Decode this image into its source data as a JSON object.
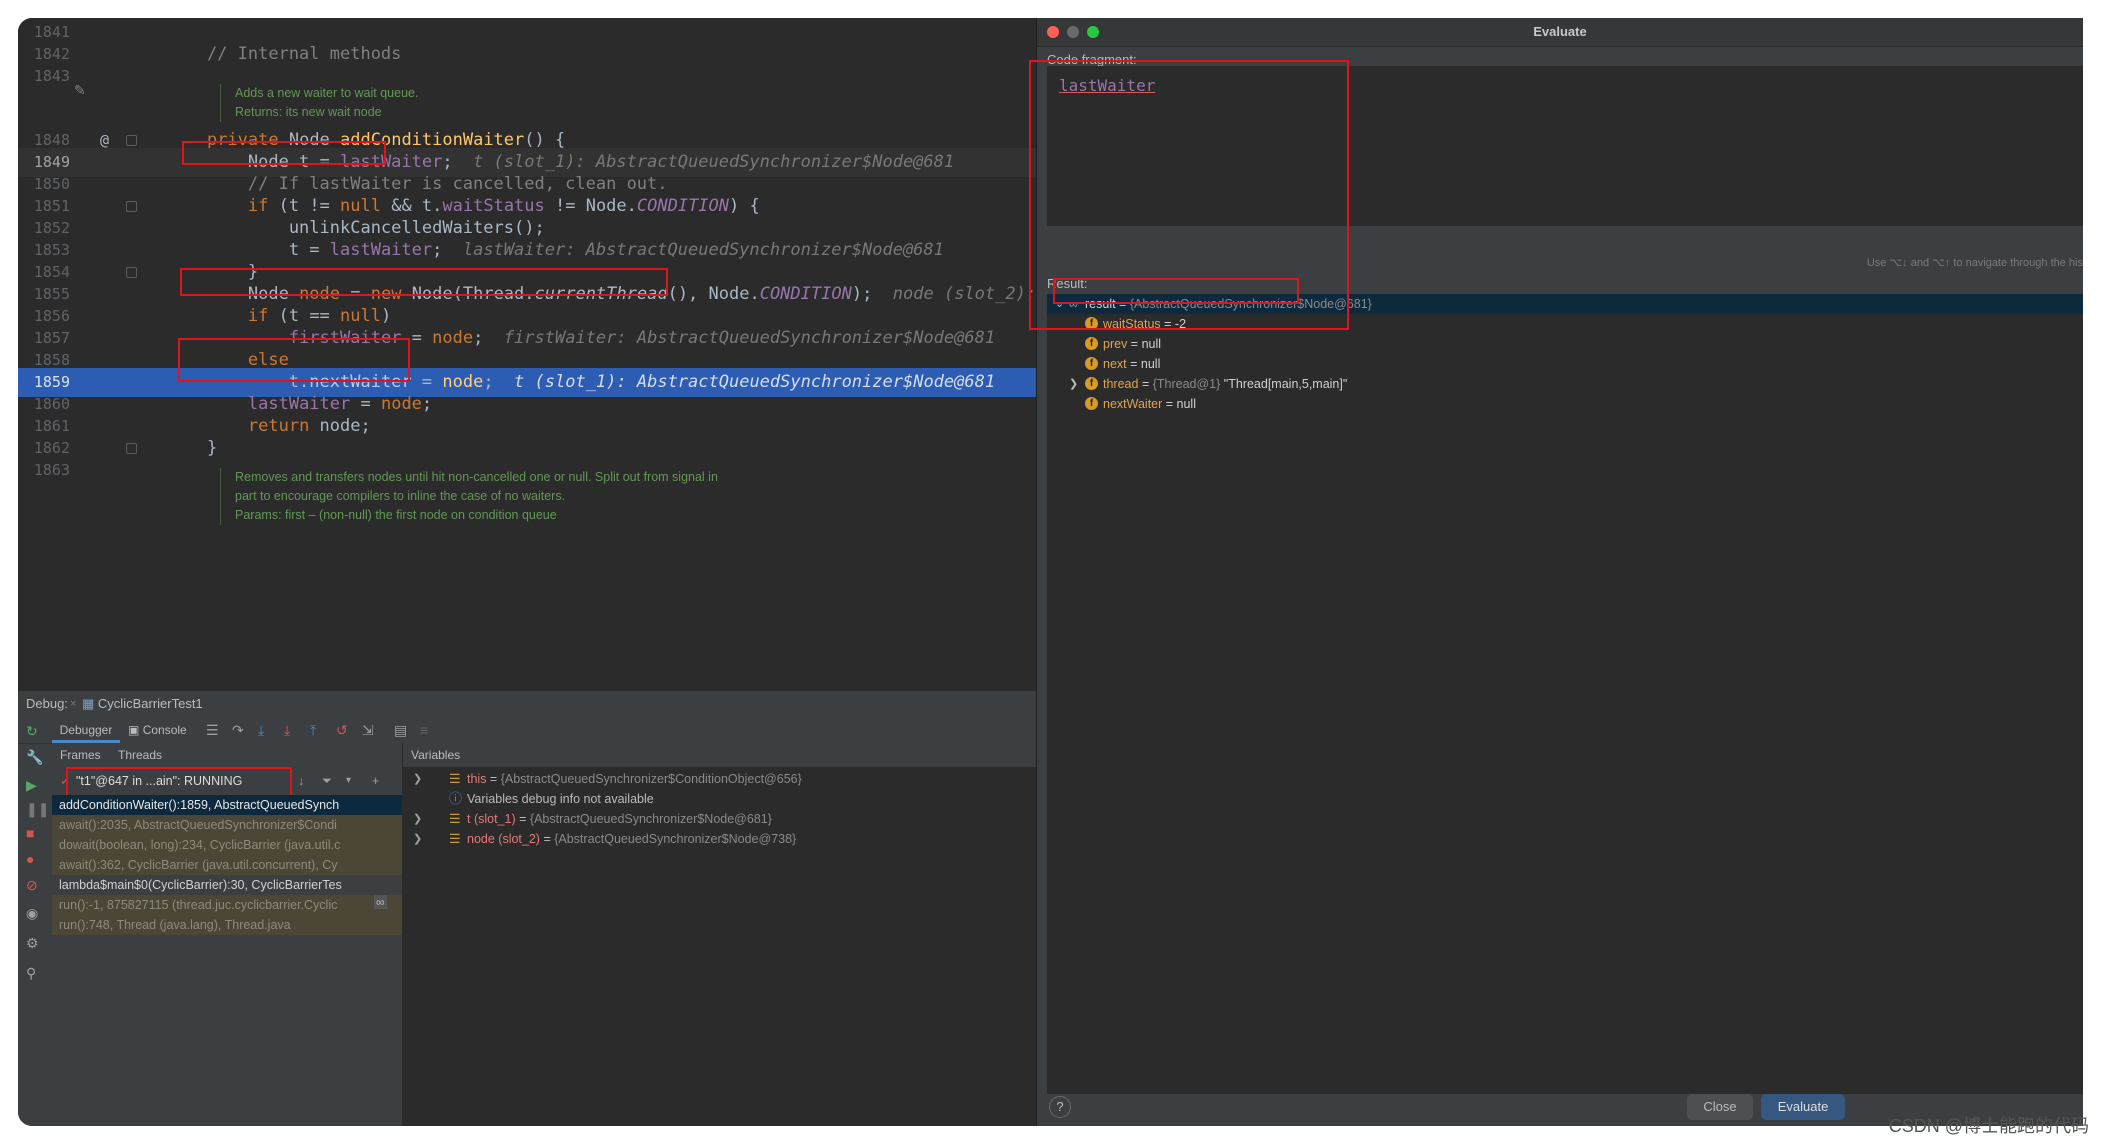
{
  "editor": {
    "lines": [
      {
        "n": "1841",
        "code": ""
      },
      {
        "n": "1842",
        "code": "    // Internal methods"
      },
      {
        "n": "1843",
        "code": ""
      },
      {
        "n": "1848",
        "code": "    private Node addConditionWaiter() {"
      },
      {
        "n": "1849",
        "code": "        Node t = lastWaiter;",
        "inline": "t (slot_1): AbstractQueuedSynchronizer$Node@681"
      },
      {
        "n": "1850",
        "code": "        // If lastWaiter is cancelled, clean out."
      },
      {
        "n": "1851",
        "code": "        if (t != null && t.waitStatus != Node.CONDITION) {"
      },
      {
        "n": "1852",
        "code": "            unlinkCancelledWaiters();"
      },
      {
        "n": "1853",
        "code": "            t = lastWaiter;",
        "inline": "lastWaiter: AbstractQueuedSynchronizer$Node@681"
      },
      {
        "n": "1854",
        "code": "        }"
      },
      {
        "n": "1855",
        "code": "        Node node = new Node(Thread.currentThread(), Node.CONDITION);",
        "inline": "node (slot_2):"
      },
      {
        "n": "1856",
        "code": "        if (t == null)"
      },
      {
        "n": "1857",
        "code": "            firstWaiter = node;",
        "inline": "firstWaiter: AbstractQueuedSynchronizer$Node@681"
      },
      {
        "n": "1858",
        "code": "        else"
      },
      {
        "n": "1859",
        "code": "            t.nextWaiter = node;",
        "inline": "t (slot_1): AbstractQueuedSynchronizer$Node@681"
      },
      {
        "n": "1860",
        "code": "        lastWaiter = node;"
      },
      {
        "n": "1861",
        "code": "        return node;"
      },
      {
        "n": "1862",
        "code": "    }"
      },
      {
        "n": "1863",
        "code": ""
      }
    ],
    "doc1": [
      "Adds a new waiter to wait queue.",
      "Returns: its new wait node"
    ],
    "doc2": [
      "Removes and transfers nodes until hit non-cancelled one or null. Split out from signal in",
      "part to encourage compilers to inline the case of no waiters.",
      "Params: first – (non-null) the first node on condition queue"
    ],
    "gutter_at": "@"
  },
  "debug": {
    "label": "Debug:",
    "session": "CyclicBarrierTest1",
    "tabs": [
      "Debugger",
      "Console"
    ],
    "subtabs": [
      "Frames",
      "Threads"
    ],
    "thread": "\"t1\"@647 in ...ain\": RUNNING",
    "frames": [
      {
        "text": "addConditionWaiter():1859, AbstractQueuedSynch",
        "kind": "sel"
      },
      {
        "text": "await():2035, AbstractQueuedSynchronizer$Condi",
        "kind": "lib"
      },
      {
        "text": "dowait(boolean, long):234, CyclicBarrier (java.util.c",
        "kind": "lib"
      },
      {
        "text": "await():362, CyclicBarrier (java.util.concurrent), Cy",
        "kind": "lib"
      },
      {
        "text": "lambda$main$0(CyclicBarrier):30, CyclicBarrierTes",
        "kind": "norm"
      },
      {
        "text": "run():-1, 875827115 (thread.juc.cyclicbarrier.Cyclic",
        "kind": "lib"
      },
      {
        "text": "run():748, Thread (java.lang), Thread.java",
        "kind": "lib"
      }
    ],
    "vars_title": "Variables",
    "vars": [
      {
        "name": "this",
        "value": "{AbstractQueuedSynchronizer$ConditionObject@656}",
        "expand": true
      },
      {
        "name": "",
        "value": "Variables debug info not available",
        "info": true
      },
      {
        "name": "t (slot_1)",
        "value": "{AbstractQueuedSynchronizer$Node@681}",
        "expand": true
      },
      {
        "name": "node (slot_2)",
        "value": "{AbstractQueuedSynchronizer$Node@738}",
        "expand": true
      }
    ]
  },
  "dialog": {
    "title": "Evaluate",
    "code_label": "Code fragment:",
    "code": "lastWaiter",
    "hint": "Use ⌥↓ and ⌥↑ to navigate through the his",
    "result_label": "Result:",
    "result_root": {
      "name": "result",
      "eq": " = ",
      "value": "{AbstractQueuedSynchronizer$Node@681}"
    },
    "fields": [
      {
        "name": "waitStatus",
        "value": "-2"
      },
      {
        "name": "prev",
        "value": "null"
      },
      {
        "name": "next",
        "value": "null"
      },
      {
        "name": "thread",
        "value_gray": "{Thread@1}",
        "value": "\"Thread[main,5,main]\"",
        "expand": true
      },
      {
        "name": "nextWaiter",
        "value": "null"
      }
    ],
    "close_label": "Close",
    "evaluate_label": "Evaluate",
    "help": "?"
  },
  "watermark": "CSDN @博士能跑的代码",
  "colors": {
    "accent": "#2d5db3",
    "red_box": "#e0141c",
    "close": "#ff5f57",
    "minimize": "#febc2e",
    "zoom": "#28c840"
  }
}
